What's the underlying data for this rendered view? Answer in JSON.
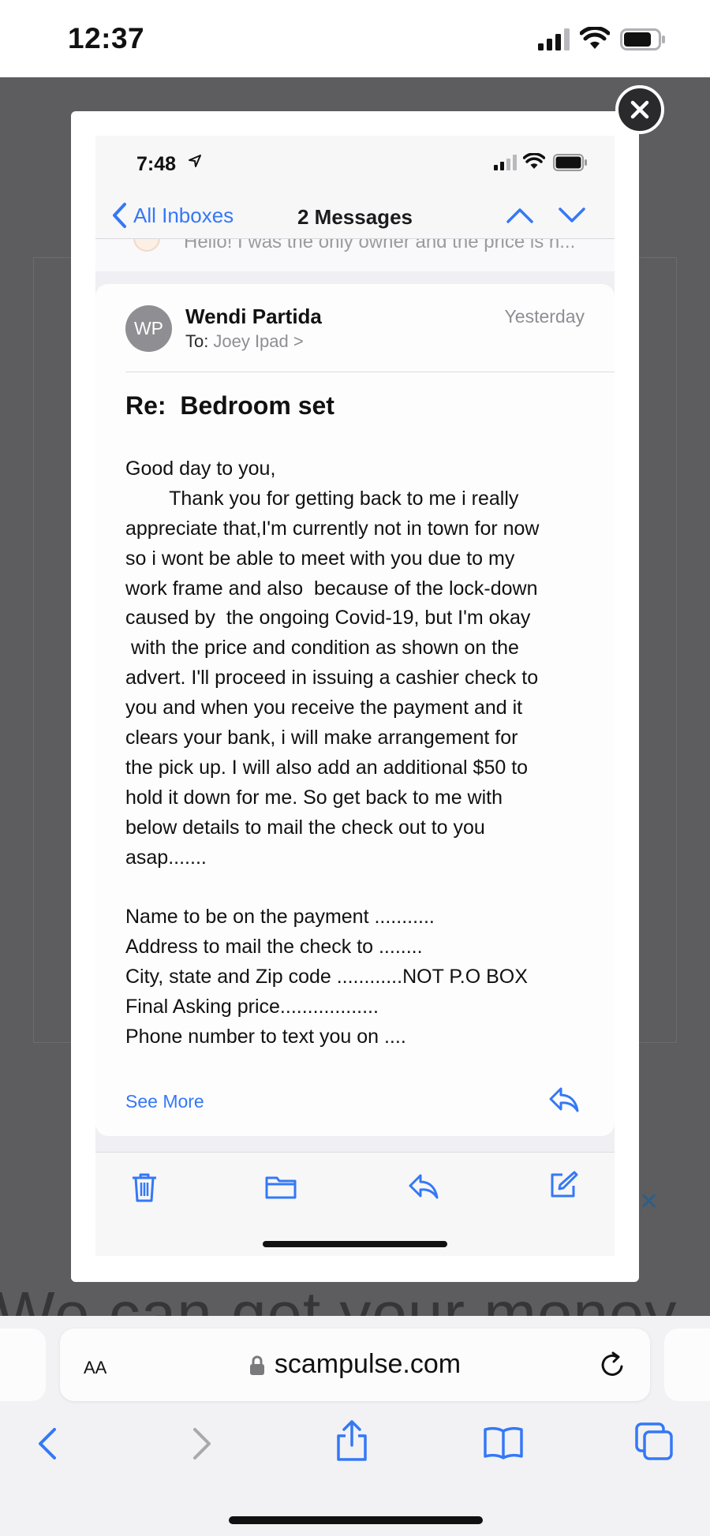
{
  "status_bar": {
    "time": "12:37",
    "signal_icon": "cellular-signal-icon",
    "wifi_icon": "wifi-icon",
    "battery_icon": "battery-icon"
  },
  "background_page": {
    "headline": "We can get your money",
    "close_symbol": "✕"
  },
  "modal": {
    "close_icon": "close-icon"
  },
  "mail_app": {
    "status_time": "7:48",
    "nav": {
      "back_label": "All Inboxes",
      "title": "2 Messages"
    },
    "previous_message_snippet": "Hello! I was the only owner and the price is n...",
    "message": {
      "avatar_initials": "WP",
      "sender": "Wendi Partida",
      "to_label": "To:",
      "recipient": "Joey Ipad >",
      "date": "Yesterday",
      "subject": "Re:  Bedroom set",
      "body_lines": [
        "Good day to you,",
        "        Thank you for getting back to me i really",
        "appreciate that,I'm currently not in town for now",
        "so i wont be able to meet with you due to my",
        "work frame and also  because of the lock-down",
        "caused by  the ongoing Covid-19, but I'm okay",
        " with the price and condition as shown on the",
        "advert. I'll proceed in issuing a cashier check to",
        "you and when you receive the payment and it",
        "clears your bank, i will make arrangement for",
        "the pick up. I will also add an additional $50 to",
        "hold it down for me. So get back to me with",
        "below details to mail the check out to you",
        "asap.......",
        "",
        "Name to be on the payment ...........",
        "Address to mail the check to ........",
        "City, state and Zip code ............NOT P.O BOX",
        "Final Asking price..................",
        "Phone number to text you on ...."
      ],
      "see_more": "See More"
    },
    "toolbar_icons": [
      "trash-icon",
      "folder-icon",
      "reply-icon",
      "compose-icon"
    ],
    "accent_color": "#3478f6"
  },
  "safari": {
    "text_size_label": "AA",
    "url": "scampulse.com",
    "lock_icon": "lock-icon",
    "reload_icon": "reload-icon",
    "nav_icons": [
      "back-icon",
      "forward-icon",
      "share-icon",
      "bookmarks-icon",
      "tabs-icon"
    ]
  }
}
